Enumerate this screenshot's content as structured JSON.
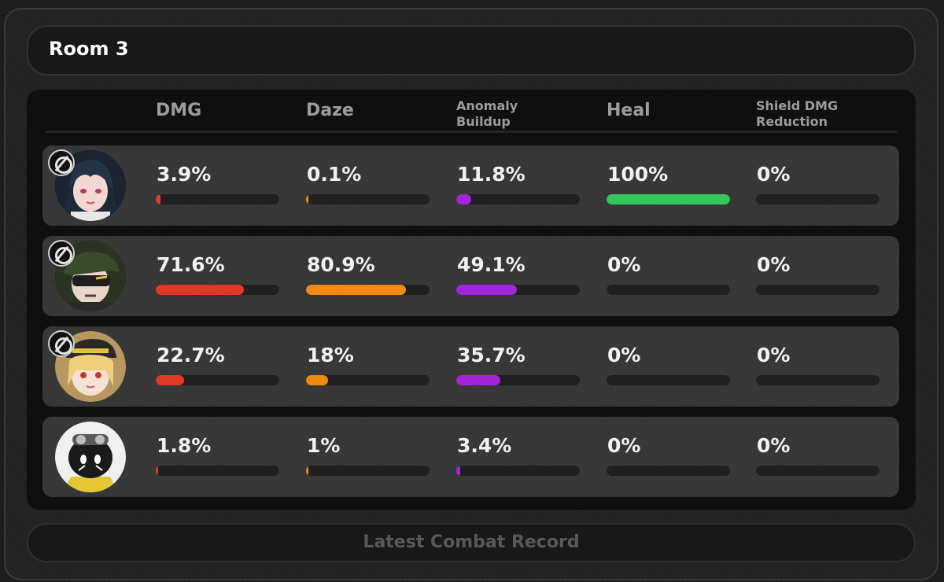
{
  "room_title": "Room 3",
  "columns": [
    {
      "key": "dmg",
      "label": "DMG"
    },
    {
      "key": "daze",
      "label": "Daze"
    },
    {
      "key": "anomaly",
      "label": "Anomaly\nBuildup"
    },
    {
      "key": "heal",
      "label": "Heal"
    },
    {
      "key": "shield",
      "label": "Shield DMG\nReduction"
    }
  ],
  "colors": {
    "dmg": "#e03a26",
    "daze": "#f08a12",
    "anomaly": "#a225d8",
    "heal": "#35c85a",
    "shield": "#3b8cf0"
  },
  "rows": [
    {
      "avatar_icon": "character-avatar-dark-hair-icon",
      "has_badge": true,
      "stats": {
        "dmg": {
          "label": "3.9%",
          "percent": 3.9
        },
        "daze": {
          "label": "0.1%",
          "percent": 0.1
        },
        "anomaly": {
          "label": "11.8%",
          "percent": 11.8
        },
        "heal": {
          "label": "100%",
          "percent": 100
        },
        "shield": {
          "label": "0%",
          "percent": 0
        }
      }
    },
    {
      "avatar_icon": "character-avatar-cap-sunglasses-icon",
      "has_badge": true,
      "stats": {
        "dmg": {
          "label": "71.6%",
          "percent": 71.6
        },
        "daze": {
          "label": "80.9%",
          "percent": 80.9
        },
        "anomaly": {
          "label": "49.1%",
          "percent": 49.1
        },
        "heal": {
          "label": "0%",
          "percent": 0
        },
        "shield": {
          "label": "0%",
          "percent": 0
        }
      }
    },
    {
      "avatar_icon": "character-avatar-blonde-cap-icon",
      "has_badge": true,
      "stats": {
        "dmg": {
          "label": "22.7%",
          "percent": 22.7
        },
        "daze": {
          "label": "18%",
          "percent": 18
        },
        "anomaly": {
          "label": "35.7%",
          "percent": 35.7
        },
        "heal": {
          "label": "0%",
          "percent": 0
        },
        "shield": {
          "label": "0%",
          "percent": 0
        }
      }
    },
    {
      "avatar_icon": "bangboo-avatar-goggles-icon",
      "has_badge": false,
      "stats": {
        "dmg": {
          "label": "1.8%",
          "percent": 1.8
        },
        "daze": {
          "label": "1%",
          "percent": 1
        },
        "anomaly": {
          "label": "3.4%",
          "percent": 3.4
        },
        "heal": {
          "label": "0%",
          "percent": 0
        },
        "shield": {
          "label": "0%",
          "percent": 0
        }
      }
    }
  ],
  "footer_button": "Latest Combat Record"
}
